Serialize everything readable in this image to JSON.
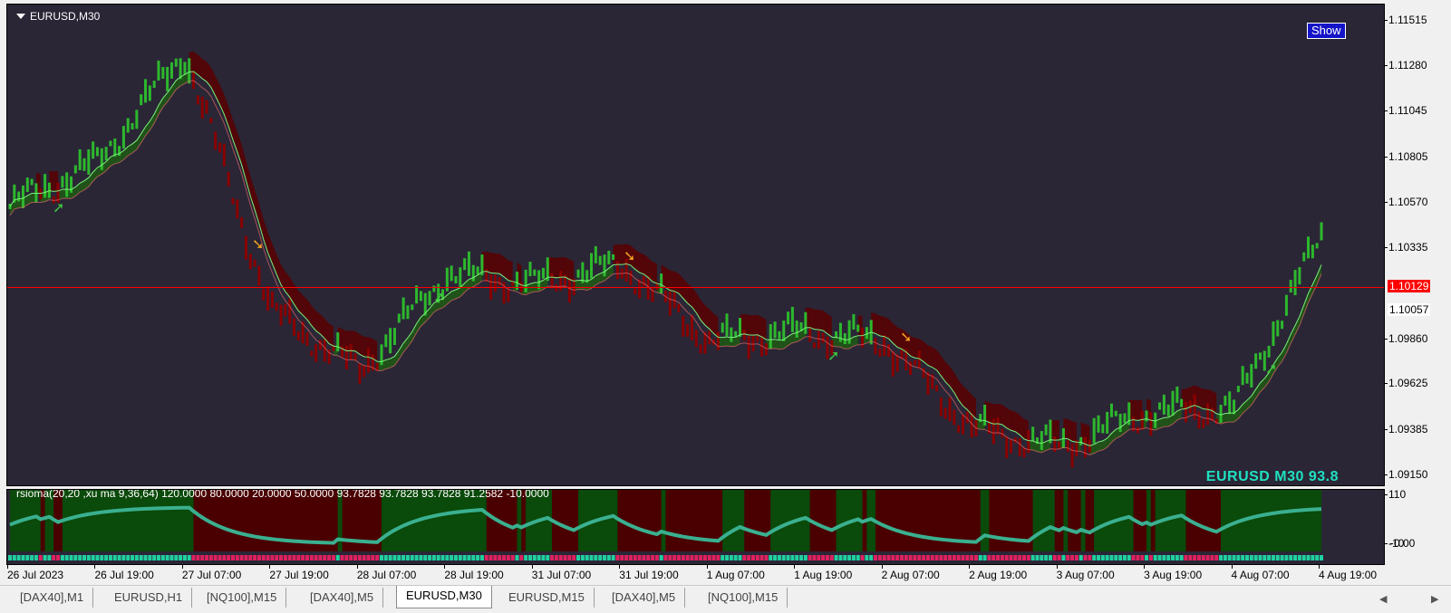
{
  "window": {
    "symbol_label": "EURUSD,M30",
    "show_button": "Show"
  },
  "watermark": "EURUSD M30  93.8",
  "price_axis": {
    "ticks": [
      "1.11515",
      "1.11280",
      "1.11045",
      "1.10805",
      "1.10570",
      "1.10335",
      "1.10129",
      "1.10057",
      "1.09860",
      "1.09625",
      "1.09385",
      "1.09150"
    ],
    "current_price_tag": "1.10129",
    "bid_tag": "1.10057",
    "current_price_color": "#ff0000"
  },
  "indicator": {
    "title": "rsioma(20,20 ,xu ma 9,36,64) 120.0000 80.0000 20.0000 50.0000 93.7828 93.7828 93.7828 91.2582 -10.0000",
    "axis_top": "110",
    "axis_bottom": "-10",
    "axis_mid": "0.00"
  },
  "time_axis": [
    "26 Jul 2023",
    "26 Jul 19:00",
    "27 Jul 07:00",
    "27 Jul 19:00",
    "28 Jul 07:00",
    "28 Jul 19:00",
    "31 Jul 07:00",
    "31 Jul 19:00",
    "1 Aug 07:00",
    "1 Aug 19:00",
    "2 Aug 07:00",
    "2 Aug 19:00",
    "3 Aug 07:00",
    "3 Aug 19:00",
    "4 Aug 07:00",
    "4 Aug 19:00"
  ],
  "tabs": [
    "[DAX40],M1",
    "EURUSD,H1",
    "[NQ100],M15",
    "[DAX40],M5",
    "EURUSD,M30",
    "EURUSD,M15",
    "[DAX40],M5",
    "[NQ100],M15"
  ],
  "active_tab": "EURUSD,M30",
  "colors": {
    "bull": "#2db82d",
    "bear": "#8a0000",
    "ribbon_up": "#1e5a14",
    "ribbon_down": "#5a0000",
    "signal_arrow_up": "#3ec83e",
    "signal_arrow_down": "#f0a020",
    "background": "#2a2636"
  },
  "chart_data": {
    "type": "line",
    "title": "EURUSD,M30",
    "x": [
      "26 Jul 2023",
      "26 Jul 19:00",
      "27 Jul 07:00",
      "27 Jul 19:00",
      "28 Jul 07:00",
      "28 Jul 19:00",
      "31 Jul 07:00",
      "31 Jul 19:00",
      "1 Aug 07:00",
      "1 Aug 19:00",
      "2 Aug 07:00",
      "2 Aug 19:00",
      "3 Aug 07:00",
      "3 Aug 19:00",
      "4 Aug 07:00",
      "4 Aug 19:00"
    ],
    "series": [
      {
        "values": [
          1.1055,
          1.1078,
          1.1135,
          1.1,
          1.097,
          1.102,
          1.1015,
          1.1025,
          1.0985,
          1.099,
          1.0985,
          1.094,
          1.093,
          1.0948,
          1.095,
          1.104
        ]
      }
    ],
    "ylim": [
      1.091,
      1.116
    ],
    "grid": false
  }
}
